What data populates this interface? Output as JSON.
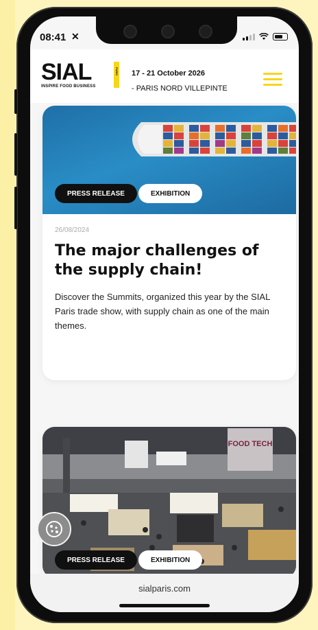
{
  "status_bar": {
    "time": "08:41"
  },
  "header": {
    "logo_text": "SIAL",
    "logo_tagline": "INSPIRE FOOD BUSINESS",
    "logo_badge": "PARIS",
    "event_dates": "17 - 21 October 2026",
    "event_venue": "- PARIS NORD VILLEPINTE",
    "menu_icon": "hamburger-menu-icon",
    "accent_color": "#f7d51a"
  },
  "articles": [
    {
      "tags": [
        "PRESS RELEASE",
        "EXHIBITION"
      ],
      "date": "26/08/2024",
      "title": "The major challenges of the supply chain!",
      "description": "Discover the Summits, organized this year by the SIAL Paris trade show, with supply chain as one of the main themes.",
      "image": "container-ship-aerial"
    },
    {
      "tags": [
        "PRESS RELEASE",
        "EXHIBITION"
      ],
      "image": "trade-show-hall",
      "image_signs": [
        "FOOD TECH"
      ]
    }
  ],
  "cookie_button": {
    "icon": "cookie-icon"
  },
  "browser": {
    "url": "sialparis.com"
  }
}
